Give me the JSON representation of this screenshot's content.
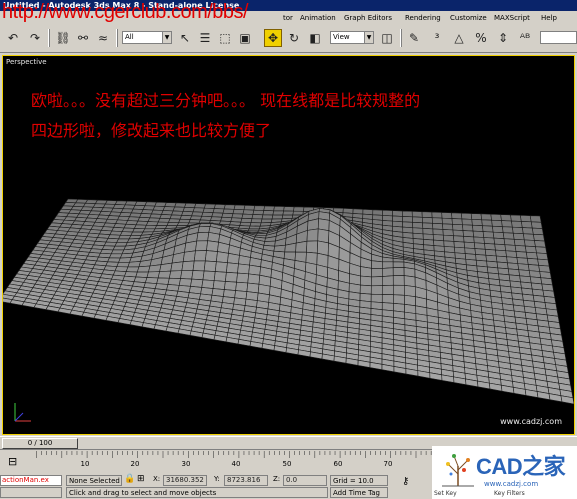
{
  "window": {
    "title": "Untitled - Autodesk 3ds Max 8 - Stand-alone License"
  },
  "watermark": {
    "url": "http://www.cgerclub.com/bbs/"
  },
  "menu": {
    "items": [
      "tor",
      "Animation",
      "Graph Editors",
      "Rendering",
      "Customize",
      "MAXScript",
      "Help"
    ]
  },
  "toolbar": {
    "selection_filter": "All",
    "reference_coord": "View"
  },
  "viewport": {
    "label": "Perspective",
    "caption_line1": "欧啦。。。没有超过三分钟吧。。。  现在线都是比较规整的",
    "caption_line2": "四边形啦，修改起来也比较方便了",
    "footer_url": "www.cadzj.com"
  },
  "timeline": {
    "slider_text": "0 / 100",
    "ticks": [
      "10",
      "20",
      "30",
      "40",
      "50",
      "60",
      "70"
    ]
  },
  "status": {
    "listener_text": "actionMan.ex",
    "selection": "None Selected",
    "x_label": "X:",
    "x_value": "31680.352",
    "y_label": "Y:",
    "y_value": "8723.816",
    "z_label": "Z:",
    "z_value": "0.0",
    "grid": "Grid = 10.0",
    "prompt": "Click and drag to select and move objects",
    "add_time_tag": "Add Time Tag"
  },
  "watermark_logo": {
    "brand": "CAD之家",
    "url": "www.cadzj.com",
    "set_key": "Set Key",
    "key_filters": "Key Filters"
  },
  "colors": {
    "caption": "#e00000",
    "active_border": "#f0d000",
    "logo_blue": "#2a64b8"
  }
}
